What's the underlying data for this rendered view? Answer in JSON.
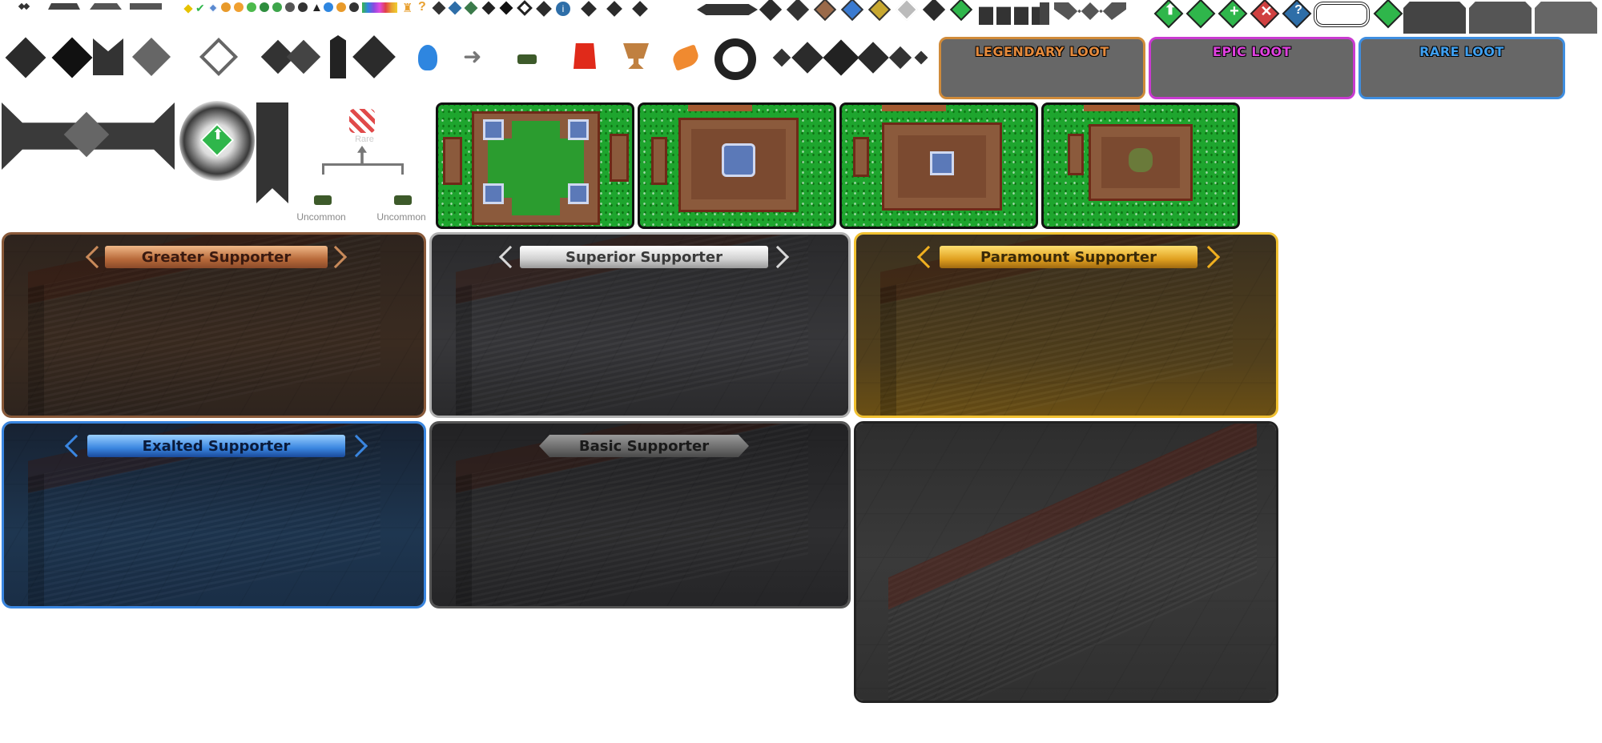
{
  "loot_boxes": {
    "legendary": {
      "label": "LEGENDARY LOOT",
      "color": "#e58a3c",
      "border": "#d08b3a"
    },
    "epic": {
      "label": "EPIC LOOT",
      "color": "#e040e0",
      "border": "#c93bd0"
    },
    "rare": {
      "label": "RARE LOOT",
      "color": "#3fa0f0",
      "border": "#3f8ee0"
    }
  },
  "upgrade_tree": {
    "top_label": "Rare",
    "left_label": "Uncommon",
    "right_label": "Uncommon"
  },
  "supporter_panels": {
    "greater": {
      "label": "Greater Supporter",
      "accent": "#c98a5a"
    },
    "superior": {
      "label": "Superior Supporter",
      "accent": "#d8d8d8"
    },
    "paramount": {
      "label": "Paramount Supporter",
      "accent": "#f0c030"
    },
    "exalted": {
      "label": "Exalted Supporter",
      "accent": "#3a86e0"
    },
    "basic": {
      "label": "Basic Supporter",
      "accent": "#7a7a7a"
    }
  },
  "icons": {
    "action_buttons": [
      "up-arrow-icon",
      "blank-diamond-icon",
      "plus-icon",
      "close-icon",
      "help-icon"
    ],
    "items": [
      "blue-crystal-icon",
      "right-arrow-icon",
      "tank-icon",
      "fries-icon",
      "trophy-icon",
      "orange-leaf-icon",
      "unity-logo-icon"
    ]
  },
  "colors": {
    "background": "#ffffff",
    "sprite_dark": "#2b2b2b",
    "success_green": "#2fb64b",
    "grass": "#1ea52e"
  }
}
